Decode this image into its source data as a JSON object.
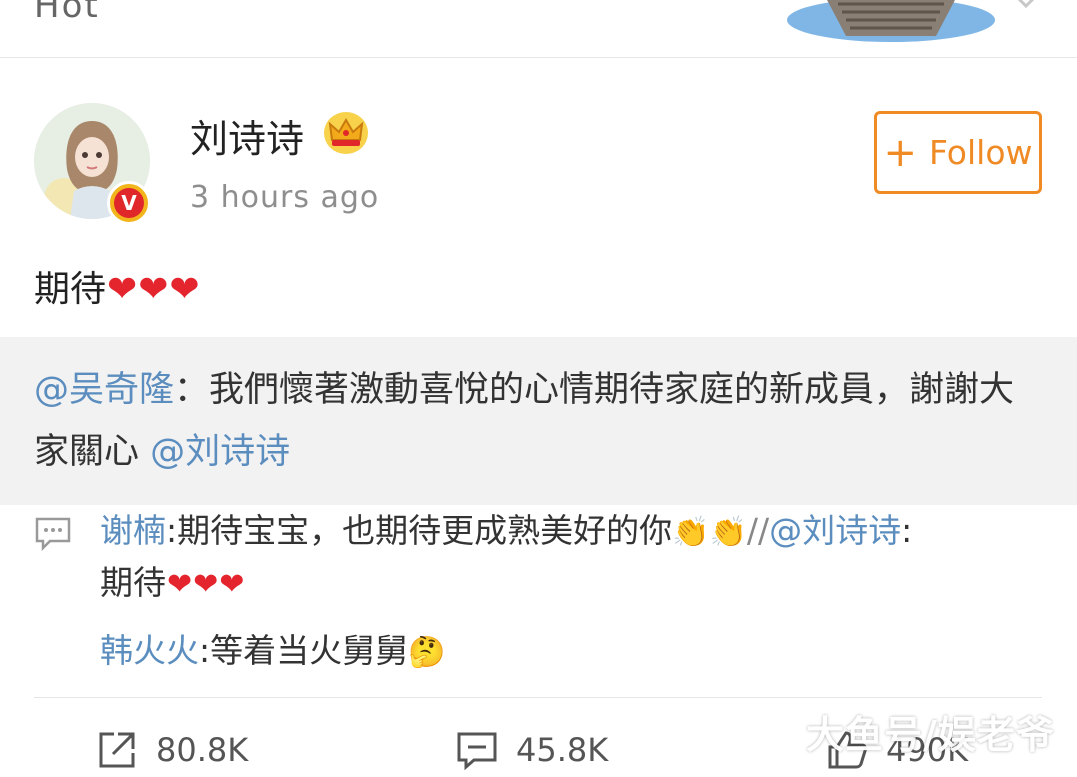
{
  "header": {
    "tab_label": "Hot"
  },
  "post": {
    "author_name": "刘诗诗",
    "timestamp": "3 hours ago",
    "follow_label": "Follow",
    "text": "期待",
    "heart_count": 3,
    "verified_badge": "V"
  },
  "repost": {
    "mention_author": "@吴奇隆",
    "body": "：我們懷著激動喜悅的心情期待家庭的新成員，謝謝大家關心 ",
    "mention_tail": "@刘诗诗"
  },
  "comments": [
    {
      "author": "谢楠",
      "text": ":期待宝宝，也期待更成熟美好的你",
      "repost_prefix": "//",
      "repost_mention": "@刘诗诗",
      "repost_colon": ":",
      "repost_text": "期待"
    },
    {
      "author": "韩火火",
      "text": ":等着当火舅舅"
    }
  ],
  "actions": {
    "share_count": "80.8K",
    "comment_count": "45.8K",
    "like_count": "490K"
  },
  "watermark": "大鱼号/娱老爷",
  "colors": {
    "link_blue": "#5b8dbf",
    "follow_orange": "#f08a24",
    "heart_red": "#e4252e",
    "repost_bg": "#f2f2f2"
  }
}
